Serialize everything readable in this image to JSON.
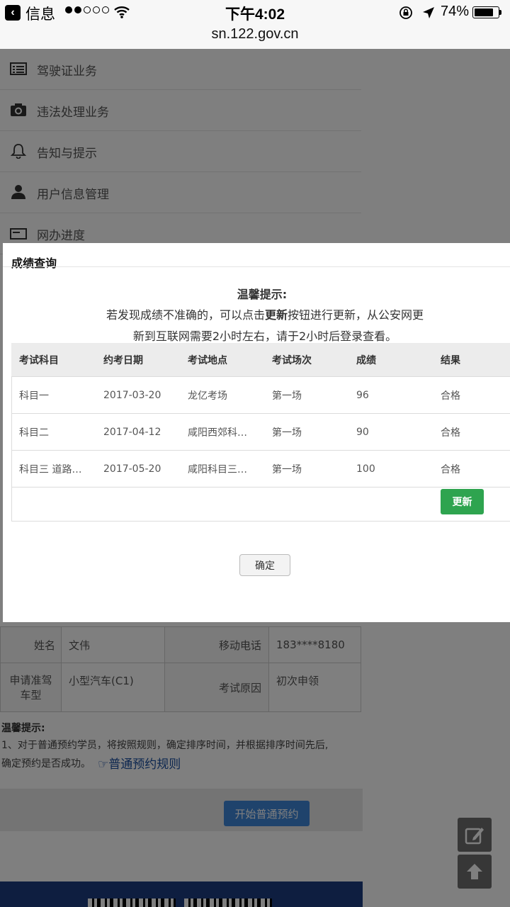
{
  "status_bar": {
    "back_label": "信息",
    "time": "下午4:02",
    "battery_percent": "74%",
    "battery_level": 0.74,
    "signal_bars_filled": 2,
    "signal_bars_total": 5
  },
  "url": "sn.122.gov.cn",
  "menu": {
    "items": [
      {
        "label": "驾驶证业务",
        "icon": "list-icon"
      },
      {
        "label": "违法处理业务",
        "icon": "camera-icon"
      },
      {
        "label": "告知与提示",
        "icon": "bell-icon"
      },
      {
        "label": "用户信息管理",
        "icon": "user-icon"
      },
      {
        "label": "网办进度",
        "icon": "progress-icon"
      }
    ]
  },
  "modal": {
    "title": "成绩查询",
    "notice_title": "温馨提示:",
    "notice_line1_pre": "若发现成绩不准确的，可以点击",
    "notice_line1_bold": "更新",
    "notice_line1_post": "按钮进行更新，从公安网更",
    "notice_line2": "新到互联网需要2小时左右，请于2小时后登录查看。",
    "table": {
      "headers": [
        "考试科目",
        "约考日期",
        "考试地点",
        "考试场次",
        "成绩",
        "结果"
      ],
      "rows": [
        [
          "科目一",
          "2017-03-20",
          "龙亿考场",
          "第一场",
          "96",
          "合格"
        ],
        [
          "科目二",
          "2017-04-12",
          "咸阳西郊科…",
          "第一场",
          "90",
          "合格"
        ],
        [
          "科目三 道路…",
          "2017-05-20",
          "咸阳科目三…",
          "第一场",
          "100",
          "合格"
        ]
      ]
    },
    "update_label": "更新",
    "confirm_label": "确定"
  },
  "applicant": {
    "name_label": "姓名",
    "name_value": "文伟",
    "phone_label": "移动电话",
    "phone_value": "183****8180",
    "type_label": "申请准驾车型",
    "type_value": "小型汽车(C1)",
    "reason_label": "考试原因",
    "reason_value": "初次申领"
  },
  "tips": {
    "title": "温馨提示:",
    "line1": "1、对于普通预约学员，将按照规则，确定排序时间，并根据排序时间先后,",
    "line2": "确定预约是否成功。",
    "link": "普通预约规则"
  },
  "start_button": "开始普通预约",
  "colors": {
    "update_green": "#2ea44f",
    "start_blue": "#3f86d8",
    "footer_navy": "#1c3d80",
    "link_blue": "#1a4fa0"
  }
}
